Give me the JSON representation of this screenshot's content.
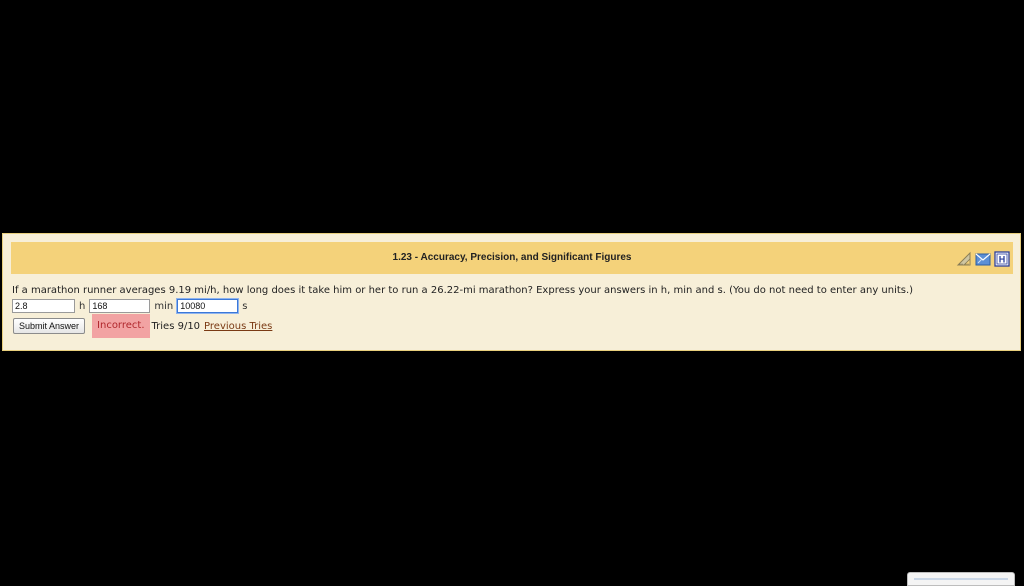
{
  "problem": {
    "title": "1.23 - Accuracy, Precision, and Significant Figures",
    "question": "If a marathon runner averages 9.19 mi/h, how long does it take him or her to run a 26.22-mi marathon? Express your answers in h, min and s. (You do not need to enter any units.)",
    "answers": [
      {
        "value": "2.8",
        "unit": "h"
      },
      {
        "value": "168",
        "unit": "min"
      },
      {
        "value": "10080",
        "unit": "s"
      }
    ],
    "submit_label": "Submit Answer",
    "status": "Incorrect.",
    "tries": "Tries 9/10",
    "previous_tries_label": "Previous Tries"
  },
  "icons": [
    "triangle-ruler-icon",
    "email-icon",
    "help-icon"
  ],
  "colors": {
    "page_background": "#000000",
    "panel_background": "#f7efd8",
    "title_bar": "#f4d27a",
    "incorrect_background": "#f2a3a3",
    "incorrect_text": "#b0272c",
    "link": "#7a3a14"
  }
}
